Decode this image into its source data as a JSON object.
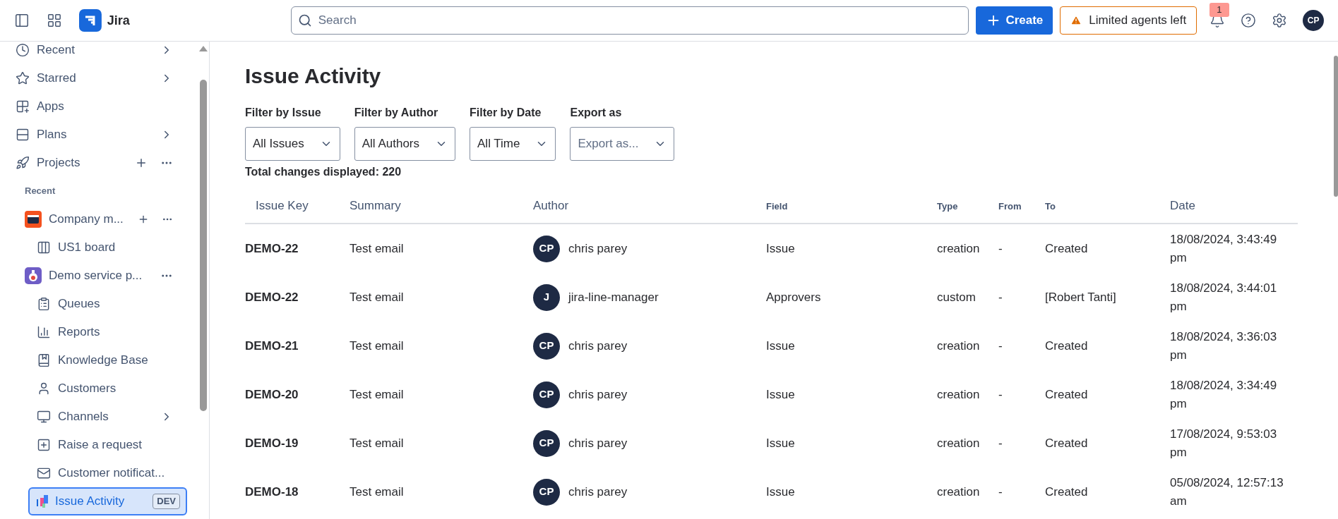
{
  "header": {
    "product": "Jira",
    "search": {
      "placeholder": "Search"
    },
    "create_button": "Create",
    "alert_button": "Limited agents left",
    "notifications": {
      "count": "1"
    },
    "avatar": "CP"
  },
  "sidebar": {
    "items": [
      {
        "kind": "nav",
        "label": "Recent",
        "chevron": true,
        "add": false,
        "more": false,
        "selected": false
      },
      {
        "kind": "nav",
        "label": "Starred",
        "chevron": true,
        "add": false,
        "more": false,
        "selected": false
      },
      {
        "kind": "nav",
        "label": "Apps",
        "chevron": false,
        "add": false,
        "more": false,
        "selected": false
      },
      {
        "kind": "nav",
        "label": "Plans",
        "chevron": true,
        "add": false,
        "more": false,
        "selected": false
      },
      {
        "kind": "nav",
        "label": "Projects",
        "chevron": false,
        "add": true,
        "more": true,
        "selected": false
      },
      {
        "kind": "section",
        "label": "Recent"
      },
      {
        "kind": "project",
        "label": "Company m...",
        "chevron": false,
        "add": true,
        "more": true,
        "selected": false
      },
      {
        "kind": "sub",
        "label": "US1 board",
        "chevron": false,
        "add": false,
        "more": false,
        "selected": false
      },
      {
        "kind": "project",
        "label": "Demo service p...",
        "chevron": false,
        "add": false,
        "more": true,
        "selected": false
      },
      {
        "kind": "sub",
        "label": "Queues",
        "chevron": false,
        "add": false,
        "more": false,
        "selected": false
      },
      {
        "kind": "sub",
        "label": "Reports",
        "chevron": false,
        "add": false,
        "more": false,
        "selected": false
      },
      {
        "kind": "sub",
        "label": "Knowledge Base",
        "chevron": false,
        "add": false,
        "more": false,
        "selected": false
      },
      {
        "kind": "sub",
        "label": "Customers",
        "chevron": false,
        "add": false,
        "more": false,
        "selected": false
      },
      {
        "kind": "sub",
        "label": "Channels",
        "chevron": true,
        "add": false,
        "more": false,
        "selected": false
      },
      {
        "kind": "sub",
        "label": "Raise a request",
        "chevron": false,
        "add": false,
        "more": false,
        "selected": false
      },
      {
        "kind": "sub",
        "label": "Customer notificat...",
        "chevron": false,
        "add": false,
        "more": false,
        "selected": false
      },
      {
        "kind": "sub",
        "label": "Issue Activity",
        "badge": "DEV",
        "chevron": false,
        "add": false,
        "more": false,
        "selected": true
      }
    ]
  },
  "page": {
    "title": "Issue Activity",
    "filters": [
      {
        "label": "Filter by Issue",
        "value": "All Issues"
      },
      {
        "label": "Filter by Author",
        "value": "All Authors"
      },
      {
        "label": "Filter by Date",
        "value": "All Time"
      },
      {
        "label": "Export as",
        "placeholder": "Export as..."
      }
    ],
    "total": "Total changes displayed: 220",
    "table": {
      "columns": [
        {
          "label": "Issue Key",
          "kind": "plain"
        },
        {
          "label": "Summary",
          "kind": "plain"
        },
        {
          "label": "Author",
          "kind": "plain"
        },
        {
          "label": "Field",
          "kind": "compact"
        },
        {
          "label": "Type",
          "kind": "compact"
        },
        {
          "label": "From",
          "kind": "compact"
        },
        {
          "label": "To",
          "kind": "compact"
        },
        {
          "label": "Date",
          "kind": "plain"
        }
      ],
      "rows": [
        {
          "key": "DEMO-22",
          "summary": "Test email",
          "avatar": "CP",
          "author": "chris parey",
          "field": "Issue",
          "type": "creation",
          "from": "-",
          "to": "Created",
          "date": "18/08/2024, 3:43:49 pm"
        },
        {
          "key": "DEMO-22",
          "summary": "Test email",
          "avatar": "J",
          "author": "jira-line-manager",
          "field": "Approvers",
          "type": "custom",
          "from": "-",
          "to": "[Robert Tanti]",
          "date": "18/08/2024, 3:44:01 pm"
        },
        {
          "key": "DEMO-21",
          "summary": "Test email",
          "avatar": "CP",
          "author": "chris parey",
          "field": "Issue",
          "type": "creation",
          "from": "-",
          "to": "Created",
          "date": "18/08/2024, 3:36:03 pm"
        },
        {
          "key": "DEMO-20",
          "summary": "Test email",
          "avatar": "CP",
          "author": "chris parey",
          "field": "Issue",
          "type": "creation",
          "from": "-",
          "to": "Created",
          "date": "18/08/2024, 3:34:49 pm"
        },
        {
          "key": "DEMO-19",
          "summary": "Test email",
          "avatar": "CP",
          "author": "chris parey",
          "field": "Issue",
          "type": "creation",
          "from": "-",
          "to": "Created",
          "date": "17/08/2024, 9:53:03 pm"
        },
        {
          "key": "DEMO-18",
          "summary": "Test email",
          "avatar": "CP",
          "author": "chris parey",
          "field": "Issue",
          "type": "creation",
          "from": "-",
          "to": "Created",
          "date": "05/08/2024, 12:57:13 am"
        }
      ]
    }
  }
}
